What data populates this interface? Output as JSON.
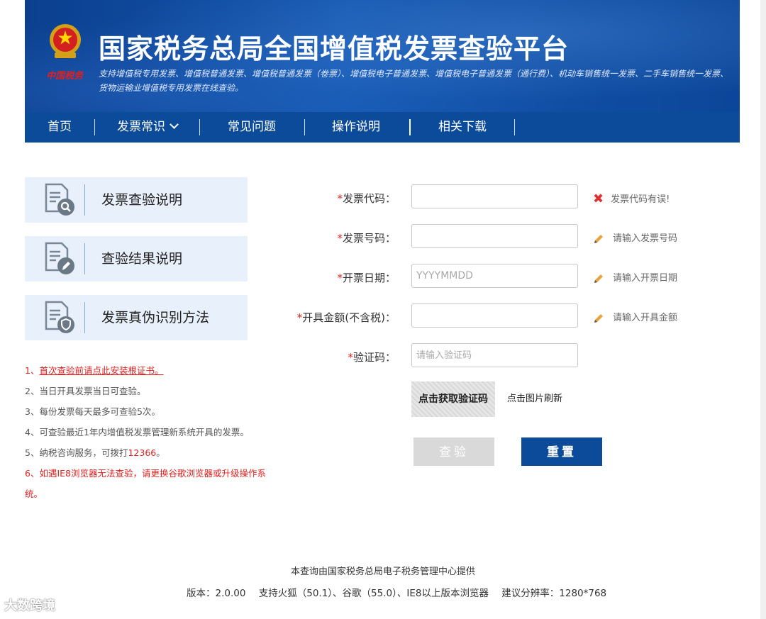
{
  "header": {
    "emblem_caption": "中国税务",
    "title": "国家税务总局全国增值税发票查验平台",
    "subtitle": "支持增值税专用发票、增值税普通发票、增值税普通发票（卷票）、增值税电子普通发票、增值税电子普通发票（通行费）、机动车销售统一发票、二手车销售统一发票、货物运输业增值税专用发票在线查验。"
  },
  "nav": {
    "items": [
      {
        "label": "首页"
      },
      {
        "label": "发票常识"
      },
      {
        "label": "常见问题"
      },
      {
        "label": "操作说明"
      },
      {
        "label": "相关下载"
      }
    ]
  },
  "sidebar": {
    "cards": [
      {
        "label": "发票查验说明",
        "icon": "doc-search-icon"
      },
      {
        "label": "查验结果说明",
        "icon": "doc-edit-icon"
      },
      {
        "label": "发票真伪识别方法",
        "icon": "doc-shield-icon"
      }
    ],
    "notes": [
      {
        "prefix": "1、",
        "text": "首次查验前请点此安装根证书。"
      },
      {
        "text": "2、当日开具发票当日可查验。"
      },
      {
        "text": "3、每份发票每天最多可查验5次。"
      },
      {
        "text": "4、可查验最近1年内增值税发票管理新系统开具的发票。"
      },
      {
        "prefix": "5、纳税咨询服务，可拨打",
        "number": "12366",
        "suffix": "。"
      },
      {
        "text": "6、如遇IE8浏览器无法查验，请更换谷歌浏览器或升级操作系统。"
      }
    ]
  },
  "form": {
    "required_mark": "*",
    "fields": [
      {
        "label": "发票代码：",
        "value": "",
        "placeholder": "",
        "hint": "发票代码有误!",
        "hint_type": "error"
      },
      {
        "label": "发票号码：",
        "value": "",
        "placeholder": "",
        "hint": "请输入发票号码",
        "hint_type": "edit"
      },
      {
        "label": "开票日期：",
        "value": "",
        "placeholder": "YYYYMMDD",
        "hint": "请输入开票日期",
        "hint_type": "edit"
      },
      {
        "label": "开具金额(不含税)：",
        "value": "",
        "placeholder": "",
        "hint": "请输入开具金额",
        "hint_type": "edit"
      },
      {
        "label": "验证码：",
        "value": "",
        "placeholder": "请输入验证码"
      }
    ],
    "captcha_text": "点击获取验证码",
    "captcha_hint": "点击图片刷新",
    "query_label": "查验",
    "reset_label": "重置"
  },
  "footer": {
    "provider": "本查询由国家税务总局电子税务管理中心提供",
    "version": "版本：2.0.00",
    "browsers": "支持火狐（50.1）、谷歌（55.0）、IE8以上版本浏览器",
    "resolution": "建议分辨率：1280*768"
  },
  "watermark": "大数跨境",
  "colors": {
    "brand_blue": "#0b4b9a",
    "error_red": "#e02020",
    "card_bg": "#e8f1fb"
  }
}
